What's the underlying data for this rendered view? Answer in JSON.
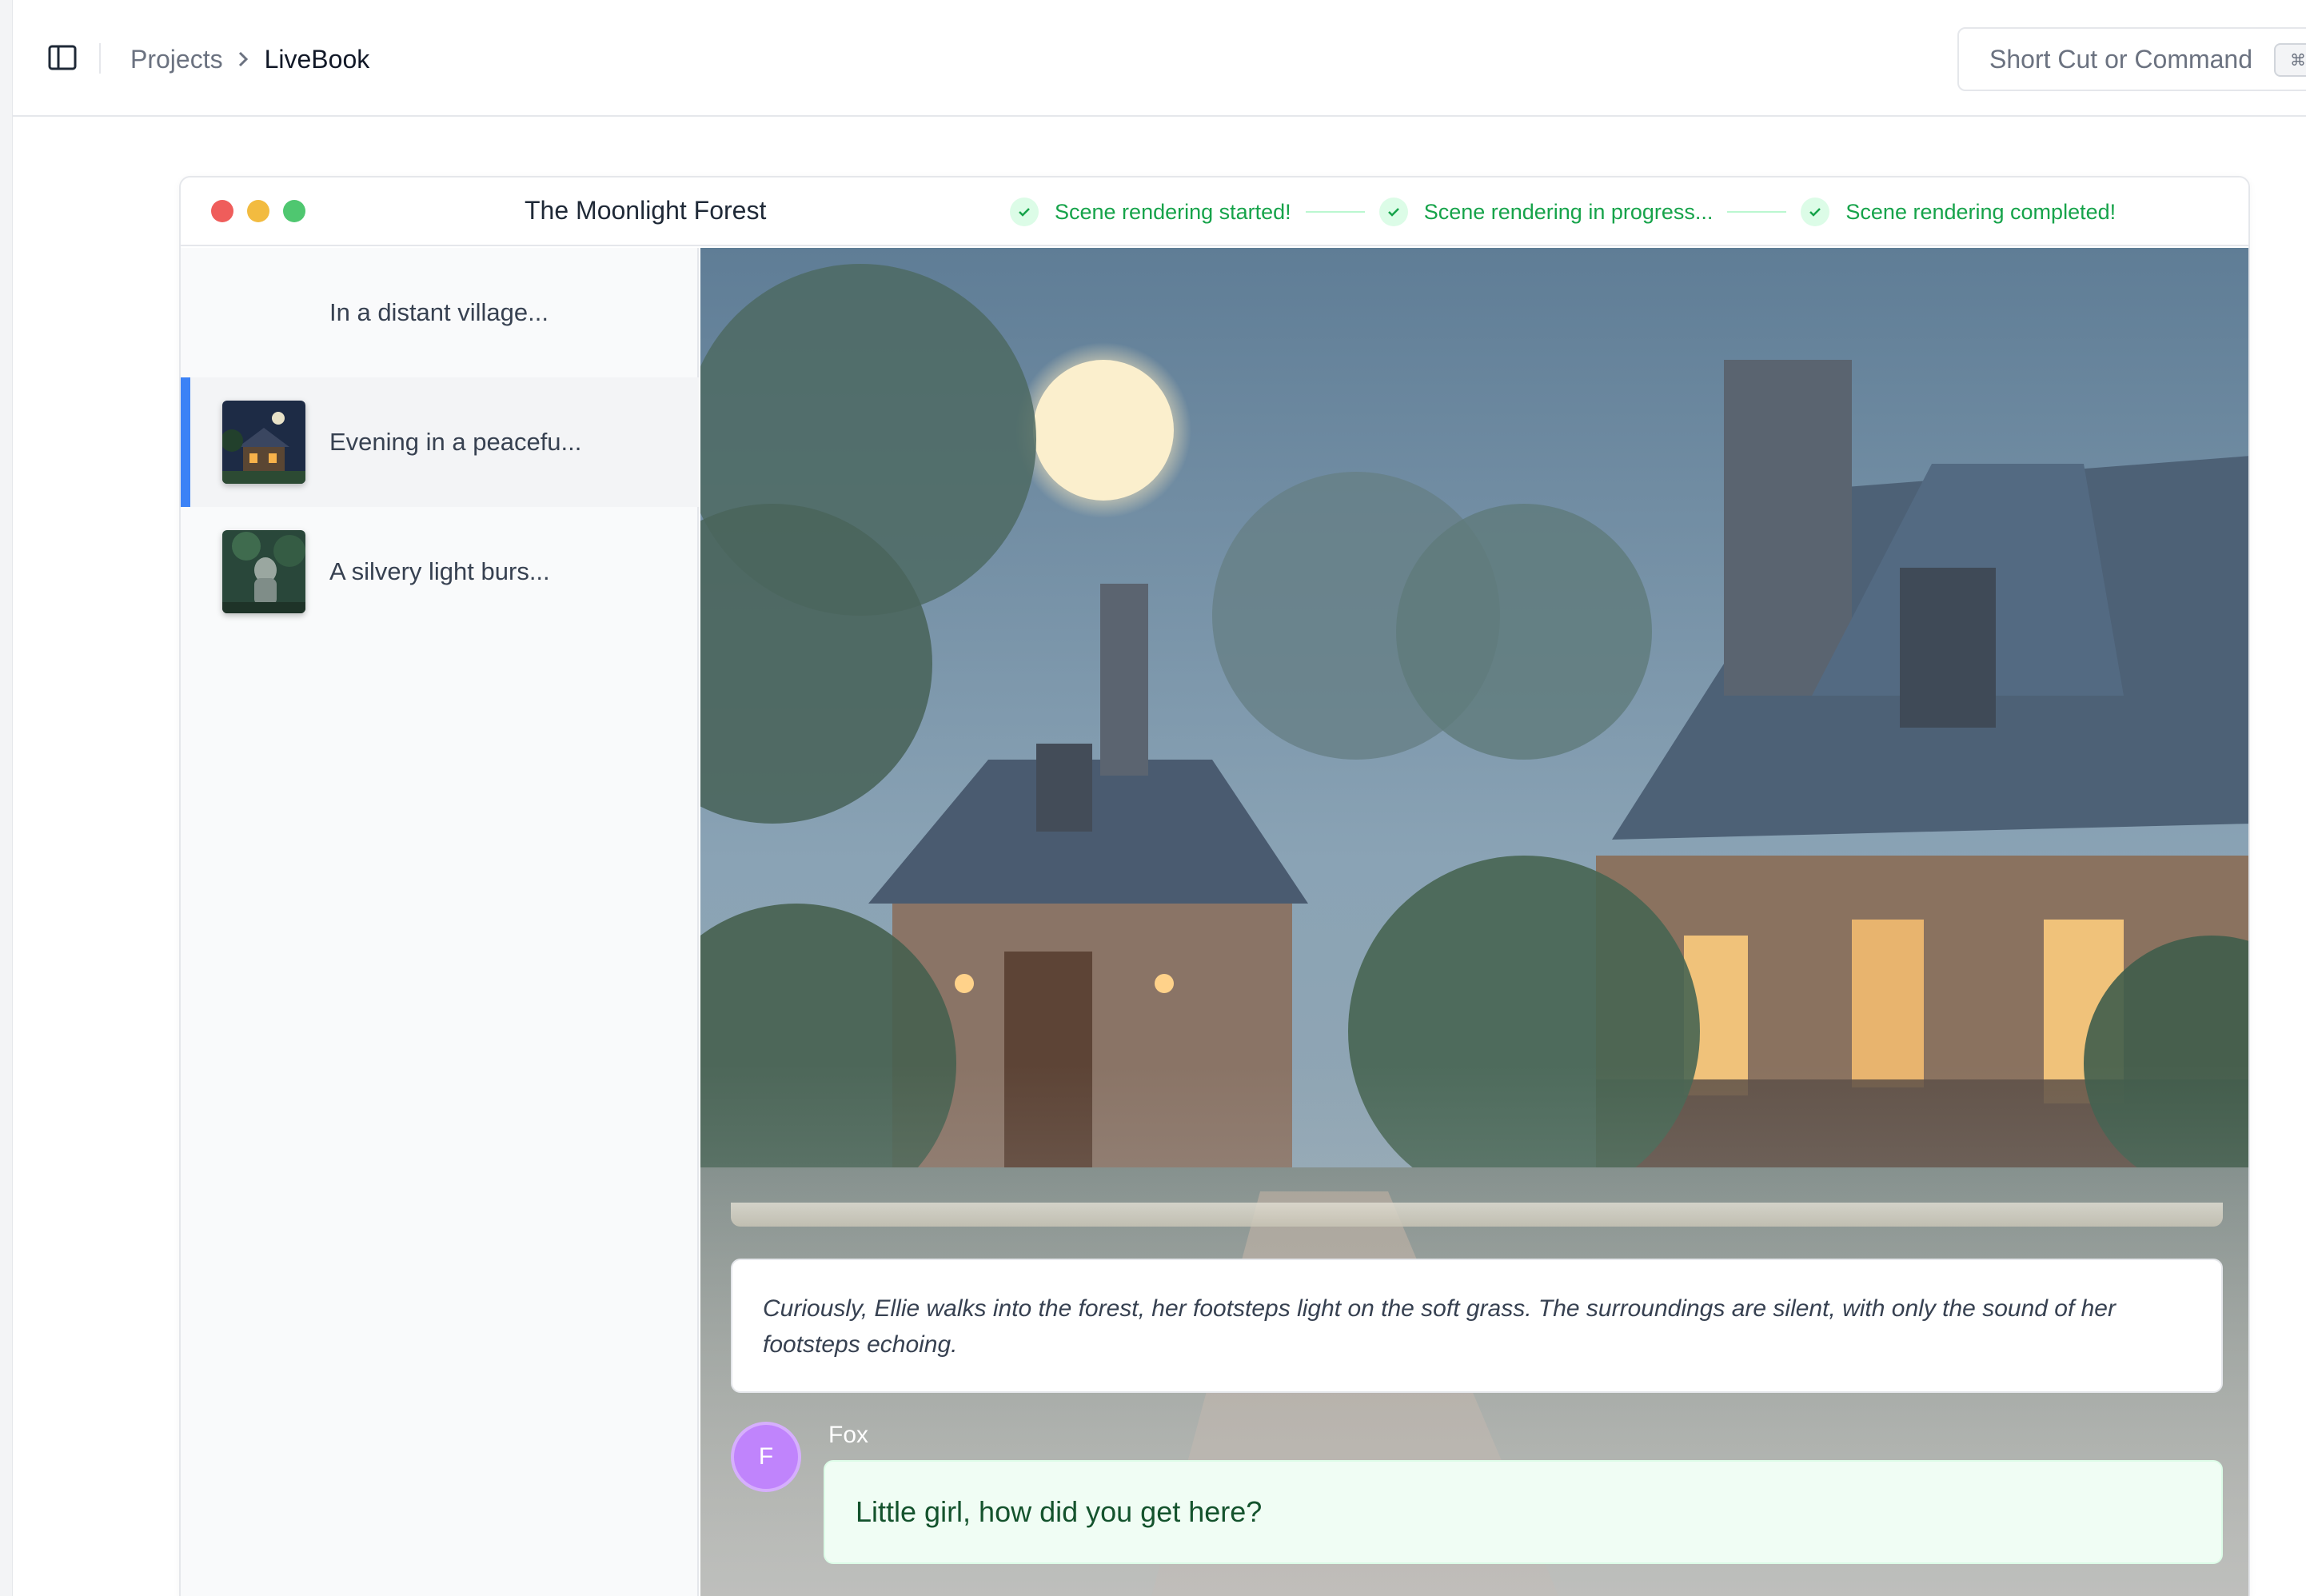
{
  "breadcrumb": {
    "projects": "Projects",
    "current": "LiveBook"
  },
  "command_bar": {
    "placeholder": "Short Cut or Command",
    "shortcut": "⌘"
  },
  "window": {
    "title": "The Moonlight Forest",
    "steps": [
      {
        "label": "Scene rendering started!"
      },
      {
        "label": "Scene rendering in progress..."
      },
      {
        "label": "Scene rendering completed!"
      }
    ]
  },
  "scenes": [
    {
      "label": "In a distant village...",
      "active": false
    },
    {
      "label": "Evening in a peacefu...",
      "active": true
    },
    {
      "label": "A silvery light burs...",
      "active": false
    }
  ],
  "scene_view": {
    "narration": "Curiously, Ellie walks into the forest, her footsteps light on the soft grass. The surroundings are silent, with only the sound of her footsteps echoing.",
    "speaker_initial": "F",
    "speaker_name": "Fox",
    "dialogue": "Little girl, how did you get here?"
  },
  "colors": {
    "accent": "#3b82f6",
    "success": "#16a34a",
    "avatar": "#c084fc"
  },
  "icons": [
    "sidebar-toggle-icon",
    "chevron-right-icon",
    "check-icon"
  ]
}
